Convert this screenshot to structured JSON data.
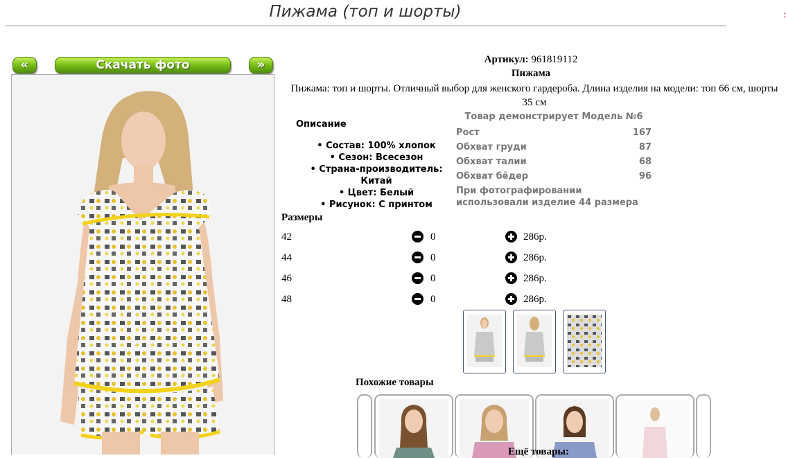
{
  "page": {
    "title": "Пижама (топ и шорты)"
  },
  "gallery": {
    "prev_label": "«",
    "download_label": "Скачать фото",
    "next_label": "»"
  },
  "product": {
    "article_label": "Артикул:",
    "article_value": "961819112",
    "name": "Пижама",
    "description": "Пижама: топ и шорты. Отличный выбор для женского гардероба. Длина изделия на модели: топ 66 см, шорты 35 см"
  },
  "details": {
    "heading": "Описание",
    "features": [
      "Состав: 100% хлопок",
      "Сезон: Всесезон",
      "Страна-производитель: Китай",
      "Цвет: Белый",
      "Рисунок: С принтом"
    ]
  },
  "model": {
    "heading": "Товар демонстрирует Модель №6",
    "rows": [
      {
        "label": "Рост",
        "value": "167"
      },
      {
        "label": "Обхват груди",
        "value": "87"
      },
      {
        "label": "Обхват талии",
        "value": "68"
      },
      {
        "label": "Обхват бёдер",
        "value": "96"
      }
    ],
    "note": "При фотографировании использовали изделие 44 размера"
  },
  "sizes": {
    "heading": "Размеры",
    "rows": [
      {
        "size": "42",
        "qty": "0",
        "price": "286р."
      },
      {
        "size": "44",
        "qty": "0",
        "price": "286р."
      },
      {
        "size": "46",
        "qty": "0",
        "price": "286р."
      },
      {
        "size": "48",
        "qty": "0",
        "price": "286р."
      }
    ]
  },
  "similar": {
    "heading": "Похожие товары",
    "more_label": "Ещё товары:"
  },
  "colors": {
    "accent_green": "#7dc21a",
    "print_yellow": "#f2d21b",
    "muted_text": "#777777"
  }
}
